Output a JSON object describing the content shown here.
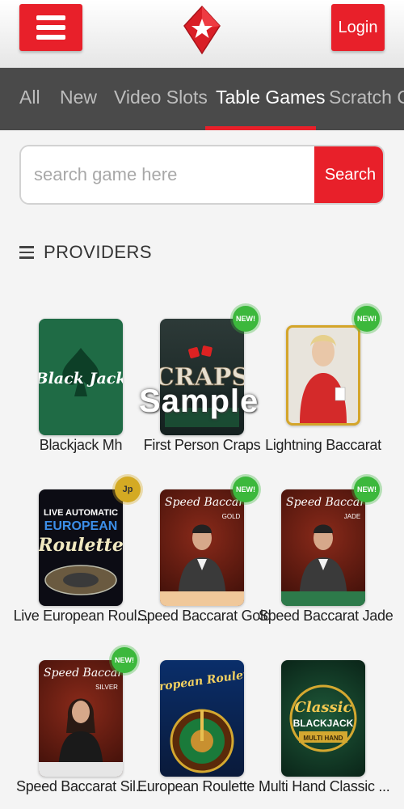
{
  "header": {
    "menu_icon": "hamburger-menu-icon",
    "logo_icon": "red-diamond-star-logo",
    "login_label": "Login",
    "accent_color": "#e8202a"
  },
  "tabs": [
    {
      "label": "All",
      "active": false
    },
    {
      "label": "New",
      "active": false
    },
    {
      "label": "Video Slots",
      "active": false
    },
    {
      "label": "Table Games",
      "active": true
    },
    {
      "label": "Scratch Ca",
      "active": false
    }
  ],
  "search": {
    "placeholder": "search game here",
    "value": "",
    "button_label": "Search"
  },
  "providers": {
    "label": "PROVIDERS",
    "icon": "hamburger-list-icon"
  },
  "games": [
    {
      "name": "Blackjack Mh",
      "thumb_text": "Black Jack",
      "badge": ""
    },
    {
      "name": "First Person Craps",
      "thumb_text": "CRAPS",
      "badge": "NEW!"
    },
    {
      "name": "Lightning Baccarat",
      "thumb_text": "",
      "badge": "NEW!"
    },
    {
      "name": "Live European Roul...",
      "thumb_text": "LIVE AUTOMATIC EUROPEAN Roulette",
      "badge": "Jp"
    },
    {
      "name": "Speed Baccarat Gold",
      "thumb_text": "Speed Baccarat GOLD",
      "badge": "NEW!"
    },
    {
      "name": "Speed Baccarat Jade",
      "thumb_text": "Speed Baccarat JADE",
      "badge": "NEW!"
    },
    {
      "name": "Speed Baccarat Sil...",
      "thumb_text": "Speed Baccarat SILVER",
      "badge": "NEW!"
    },
    {
      "name": "European Roulette ...",
      "thumb_text": "European Roulette",
      "badge": ""
    },
    {
      "name": "Multi Hand Classic ...",
      "thumb_text": "Classic BLACKJACK MULTI HAND",
      "badge": ""
    }
  ],
  "watermark": "Sample"
}
